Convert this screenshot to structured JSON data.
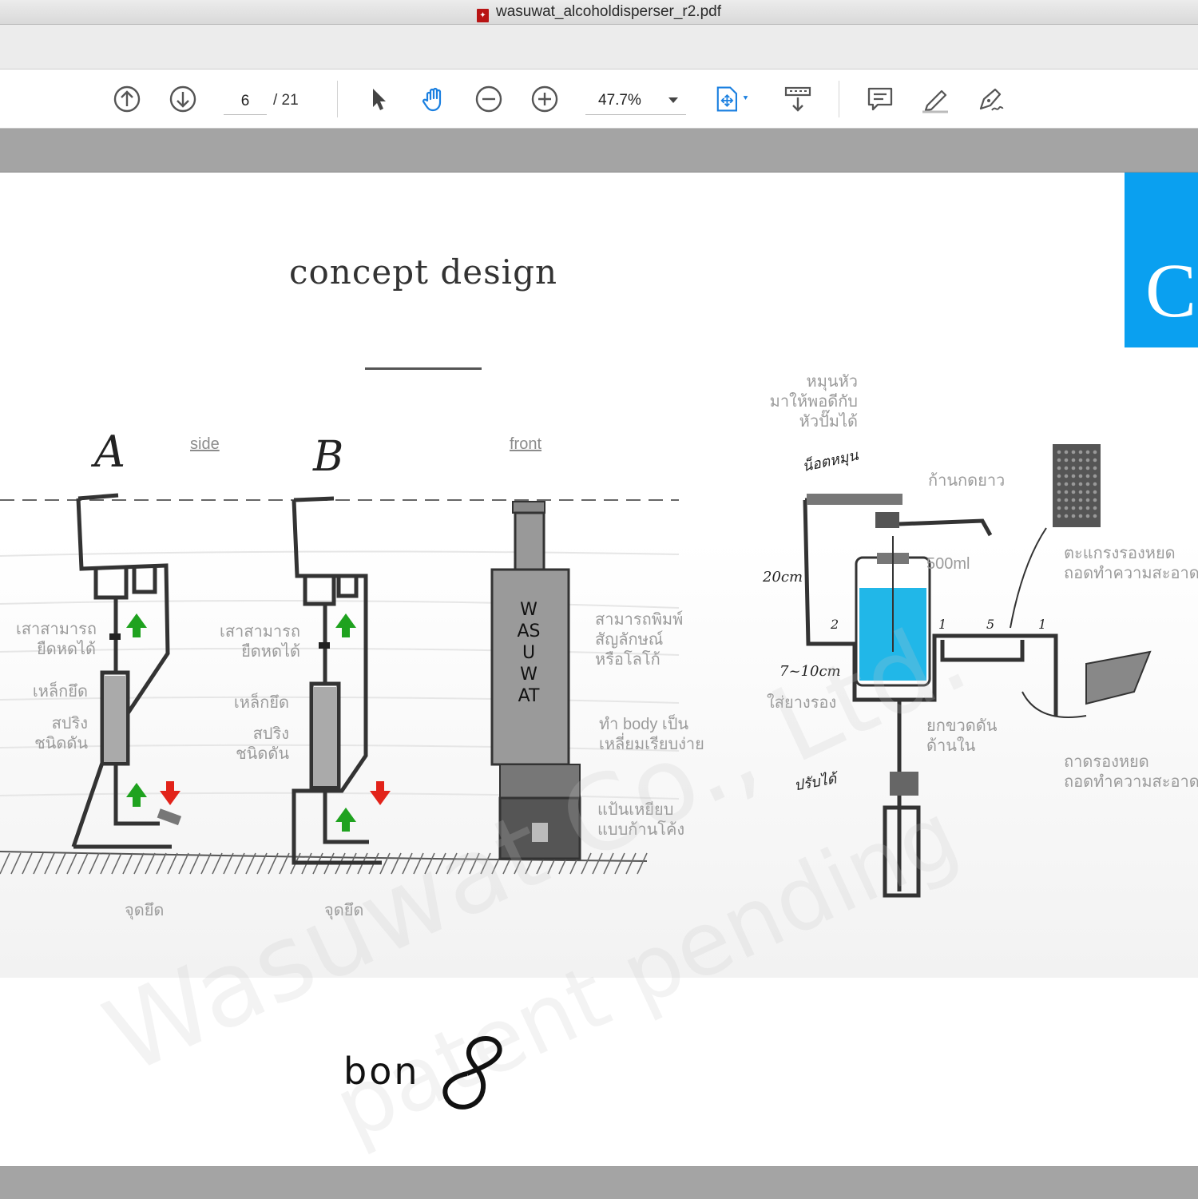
{
  "window": {
    "title": "wasuwat_alcoholdisperser_r2.pdf"
  },
  "toolbar": {
    "page_current": "6",
    "page_total": "/  21",
    "zoom": "47.7%",
    "icons": [
      "arrow-up-circle-icon",
      "arrow-down-circle-icon",
      "select-pointer-icon",
      "hand-icon",
      "zoom-out-icon",
      "zoom-in-icon",
      "fit-page-icon",
      "download-scroll-icon",
      "comment-icon",
      "highlight-pen-icon",
      "sign-pen-icon"
    ],
    "accent": "#1a7fe0"
  },
  "page": {
    "title": "concept design",
    "blue_tab": "C",
    "tab_color": "#0aa0f0",
    "labels": {
      "A": "A",
      "B": "B",
      "side": "side",
      "front": "front",
      "pole_a": "เสาสามารถ\nยืดหดได้",
      "pole_b": "เสาสามารถ\nยืดหดได้",
      "steel_a": "เหล็กยึด",
      "steel_b": "เหล็กยึด",
      "spring_a": "สปริง\nชนิดดัน",
      "spring_b": "สปริง\nชนิดดัน",
      "anchor_a": "จุดยึด",
      "anchor_b": "จุดยึด",
      "print_logo": "สามารถพิมพ์\nสัญลักษณ์\nหรือโลโก้",
      "body_shape": "ทำ body เป็น\nเหลี่ยมเรียบง่าย",
      "pedal": "แป้นเหยียบ\nแบบก้านโค้ง",
      "rotate_head": "หมุนหัว\nมาให้พอดีกับ\nหัวปั๊มได้",
      "long_rod": "ก้านกดยาว",
      "volume": "500ml",
      "grate": "ตะแกรงรองหยด\nถอดทำความสะอาดได้",
      "rubber_pad": "ใส่ยางรอง",
      "lift_bottle": "ยกขวดดัน\nด้านใน",
      "tray": "ถาดรองหยด\nถอดทำความสะอาดได้",
      "bottle_text": "WASUWAT",
      "hand_top": "น็อตหมุน",
      "hand_20": "20cm",
      "hand_7": "7~10cm",
      "hand_adjust": "ปรับได้",
      "n1": "1",
      "n2": "2",
      "n5": "5",
      "n1b": "1"
    },
    "logo": "bon",
    "watermark_1": "Wasuwat Co., Ltd.",
    "watermark_2": "patent pending"
  }
}
